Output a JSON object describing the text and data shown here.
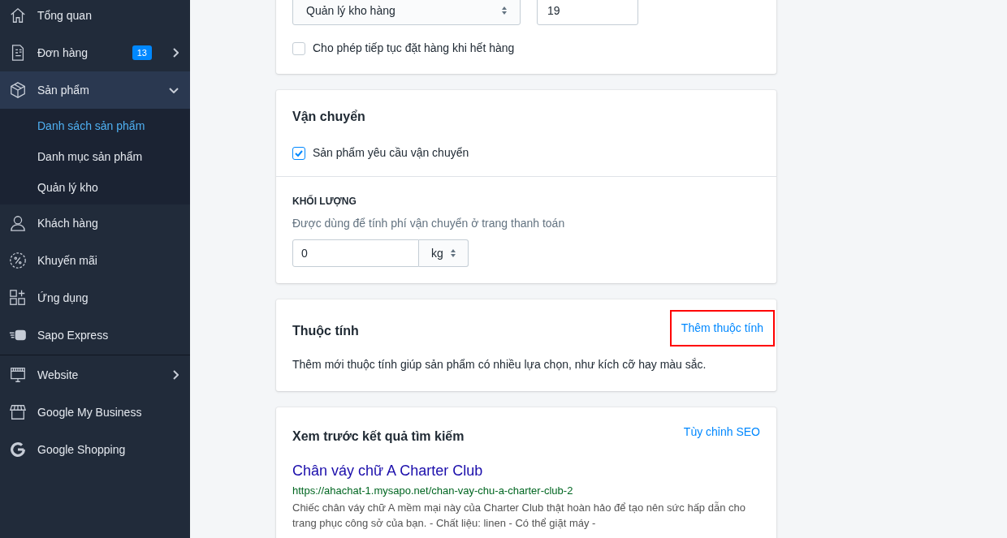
{
  "sidebar": {
    "sections": [
      {
        "items": [
          {
            "label": "Tổng quan",
            "selected": false
          },
          {
            "label": "Đơn hàng",
            "badge": "13",
            "expanded": false,
            "selected": false
          },
          {
            "label": "Sản phẩm",
            "expanded": true,
            "selected": true,
            "children": [
              {
                "label": "Danh sách sản phẩm",
                "selected": true
              },
              {
                "label": "Danh mục sản phẩm",
                "selected": false
              },
              {
                "label": "Quản lý kho",
                "selected": false
              }
            ]
          },
          {
            "label": "Khách hàng",
            "selected": false
          },
          {
            "label": "Khuyến mãi",
            "selected": false
          },
          {
            "label": "Ứng dụng",
            "selected": false
          },
          {
            "label": "Sapo Express",
            "selected": false
          }
        ]
      },
      {
        "items": [
          {
            "label": "Website",
            "expanded": false,
            "selected": false
          },
          {
            "label": "Google My Business",
            "selected": false
          },
          {
            "label": "Google Shopping",
            "selected": false
          }
        ]
      }
    ]
  },
  "inventory": {
    "policy": "Quản lý kho hàng",
    "quantity": "19",
    "continue_selling": {
      "label": "Cho phép tiếp tục đặt hàng khi hết hàng",
      "checked": false
    }
  },
  "shipping": {
    "title": "Vận chuyển",
    "requires_shipping": {
      "label": "Sản phẩm yêu cầu vận chuyển",
      "checked": true
    },
    "weight_heading": "KHỐI LƯỢNG",
    "weight_hint": "Được dùng để tính phí vận chuyển ở trang thanh toán",
    "weight": "0",
    "unit": "kg"
  },
  "attributes": {
    "title": "Thuộc tính",
    "action": {
      "label": "Thêm thuộc tính",
      "highlighted": true
    },
    "description": "Thêm mới thuộc tính giúp sản phẩm có nhiều lựa chọn, như kích cỡ hay màu sắc."
  },
  "seo": {
    "title": "Xem trước kết quả tìm kiếm",
    "action": "Tùy chỉnh SEO",
    "preview_title": "Chân váy chữ A Charter Club",
    "preview_url": "https://ahachat-1.mysapo.net/chan-vay-chu-a-charter-club-2",
    "preview_description": "Chiếc chân váy chữ A mềm mại này của Charter Club thật hoàn hảo để tạo nên sức hấp dẫn cho trang phục công sở của bạn. - Chất liệu: linen - Có thể giặt máy -"
  }
}
